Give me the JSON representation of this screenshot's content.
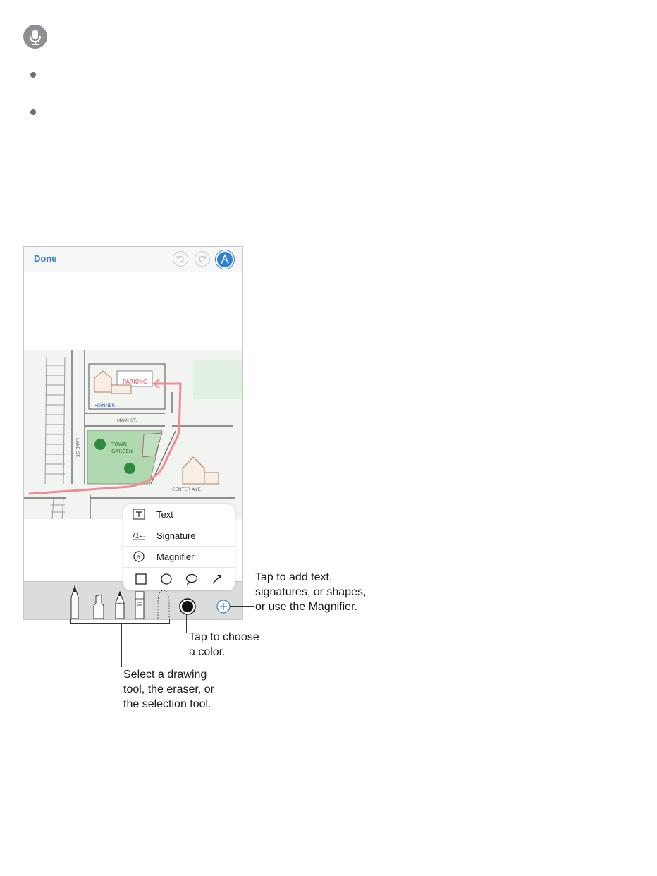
{
  "page": {
    "bullets": [
      "",
      ""
    ]
  },
  "markup_screen": {
    "done_label": "Done",
    "map_labels": {
      "parking": "PARKING",
      "dinner": "•DINNER",
      "main_st": "MAIN ST.",
      "lake_st": "LAKE ST.",
      "town_garden_line1": "TOWN",
      "town_garden_line2": "GARDEN",
      "center_ave": "CENTER AVE."
    },
    "menu": {
      "items": [
        {
          "label": "Text",
          "icon": "text-box-icon"
        },
        {
          "label": "Signature",
          "icon": "signature-icon"
        },
        {
          "label": "Magnifier",
          "icon": "magnifier-icon"
        }
      ],
      "shapes": [
        "square-icon",
        "circle-icon",
        "speech-bubble-icon",
        "arrow-icon"
      ]
    },
    "tools": [
      "pen-icon",
      "highlighter-icon",
      "pencil-icon",
      "eraser-icon",
      "lasso-icon",
      "color-well-icon",
      "add-icon"
    ]
  },
  "callouts": {
    "add_text": [
      "Tap to add text,",
      "signatures, or shapes,",
      "or use the Magnifier."
    ],
    "color": [
      "Tap to choose",
      "a color."
    ],
    "drawing_tool": [
      "Select a drawing",
      "tool, the eraser, or",
      "the selection tool."
    ]
  },
  "colors": {
    "accent": "#2f7ed8",
    "route": "#f28a93",
    "garden": "#86c786"
  }
}
